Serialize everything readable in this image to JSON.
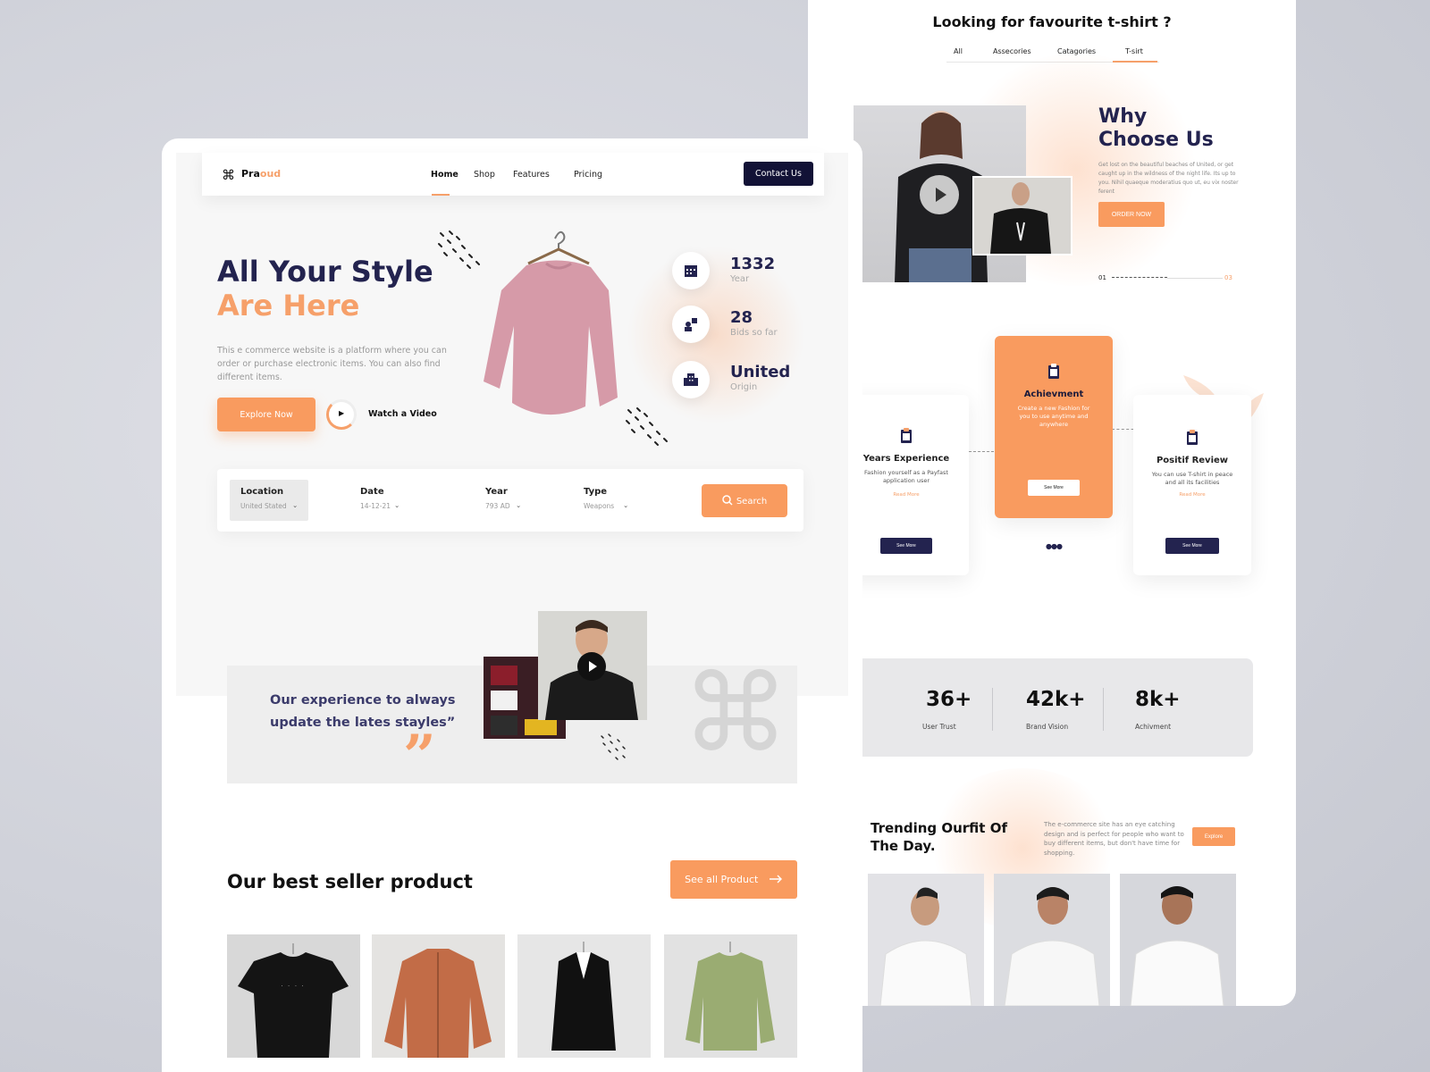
{
  "right": {
    "title": "Looking for favourite t-shirt ?",
    "tabs": [
      "All",
      "Assecories",
      "Catagories",
      "T-sirt"
    ],
    "why_title_1": "Why",
    "why_title_2": "Choose Us",
    "why_text": "Get lost on the beautiful beaches of United, or get caught up in the wildness of the night life. Its up to you. Nihil quaeque moderatius quo ut, eu vix noster ferent",
    "order_now": "ORDER NOW",
    "slide_start": "01",
    "slide_end": "03",
    "cards": [
      {
        "title": "Years Experience",
        "desc": "Fashion yourself as a Payfast application user",
        "read_more": "Read More",
        "button": "See More"
      },
      {
        "title": "Achievment",
        "desc": "Create a new Fashion for you to use anytime and anywhere",
        "button": "See More"
      },
      {
        "title": "Positif Review",
        "desc": "You can use T-shirt in peace and all its facilities",
        "read_more": "Read More",
        "button": "See More"
      }
    ],
    "stats": [
      {
        "value": "36+",
        "label": "User Trust"
      },
      {
        "value": "42k+",
        "label": "Brand  Vision"
      },
      {
        "value": "8k+",
        "label": "Achivment"
      }
    ],
    "trend_title": "Trending Ourfit Of The Day.",
    "trend_text": "The e-commerce site has an eye catching design and is perfect for people who want to buy different items, but don't have time for shopping.",
    "explore": "Explore"
  },
  "left": {
    "logo_a": "Pra",
    "logo_b": "oud",
    "nav": [
      "Home",
      "Shop",
      "Features",
      "Pricing"
    ],
    "contact": "Contact Us",
    "hero_line1": "All Your Style",
    "hero_line2": "Are Here",
    "hero_text": "This e commerce website is a platform where you can order or purchase electronic items. You can also find different items.",
    "explore_now": "Explore Now",
    "watch_video": "Watch a Video",
    "hero_stats": [
      {
        "value": "1332",
        "label": "Year"
      },
      {
        "value": "28",
        "label": "Bids so far"
      },
      {
        "value": "United",
        "label": "Origin"
      }
    ],
    "filters": [
      {
        "label": "Location",
        "value": "United Stated"
      },
      {
        "label": "Date",
        "value": "14-12-21"
      },
      {
        "label": "Year",
        "value": "793 AD"
      },
      {
        "label": "Type",
        "value": "Weapons"
      }
    ],
    "search": "Search",
    "quote": "Our experience to always update the lates stayles”",
    "quote_mark": "”",
    "best_title": "Our best seller product",
    "see_all": "See all Product"
  },
  "colors": {
    "accent": "#F99B5F",
    "navy": "#23234F",
    "dark_button": "#121236"
  }
}
